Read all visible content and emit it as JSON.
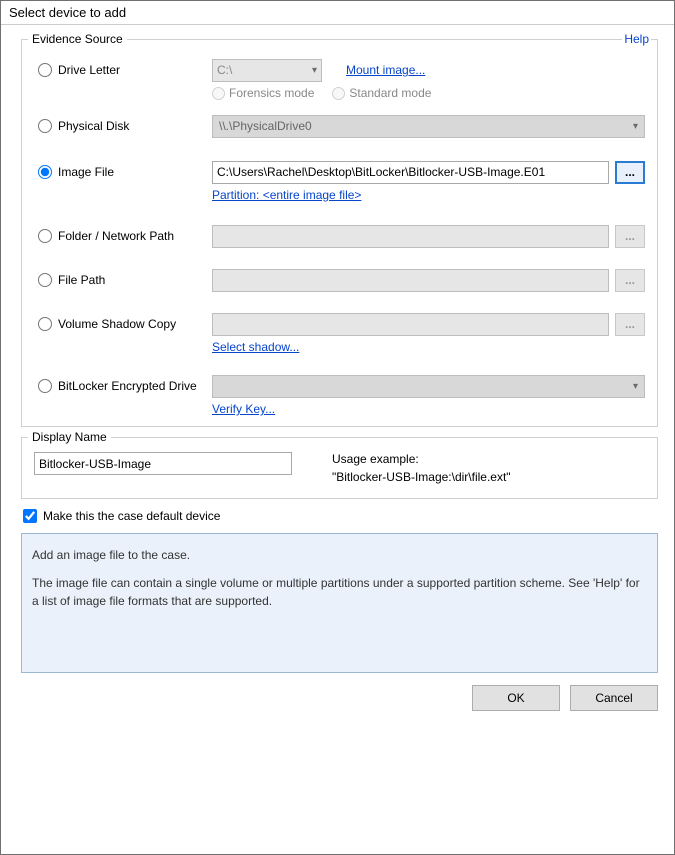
{
  "window": {
    "title": "Select device to add"
  },
  "evidence": {
    "legend": "Evidence Source",
    "help": "Help",
    "drive_letter": {
      "label": "Drive Letter",
      "value": "C:\\",
      "mount_link": "Mount image...",
      "forensics_label": "Forensics mode",
      "standard_label": "Standard mode"
    },
    "physical_disk": {
      "label": "Physical Disk",
      "value": "\\\\.\\PhysicalDrive0"
    },
    "image_file": {
      "label": "Image File",
      "value": "C:\\Users\\Rachel\\Desktop\\BitLocker\\Bitlocker-USB-Image.E01",
      "partition_link": "Partition: <entire image file>",
      "browse": "..."
    },
    "folder_path": {
      "label": "Folder / Network Path",
      "browse": "..."
    },
    "file_path": {
      "label": "File Path",
      "browse": "..."
    },
    "shadow": {
      "label": "Volume Shadow Copy",
      "browse": "...",
      "link": "Select shadow..."
    },
    "bitlocker": {
      "label": "BitLocker Encrypted Drive",
      "link": "Verify Key..."
    }
  },
  "display_name": {
    "legend": "Display Name",
    "value": "Bitlocker-USB-Image",
    "usage_label": "Usage example:",
    "usage_value": "\"Bitlocker-USB-Image:\\dir\\file.ext\""
  },
  "default_checkbox": "Make this the case default device",
  "info": {
    "line1": "Add an image file to the case.",
    "line2": "The image file can contain a single volume or multiple partitions under a supported partition scheme. See 'Help' for a list of image file formats that are supported."
  },
  "buttons": {
    "ok": "OK",
    "cancel": "Cancel"
  }
}
